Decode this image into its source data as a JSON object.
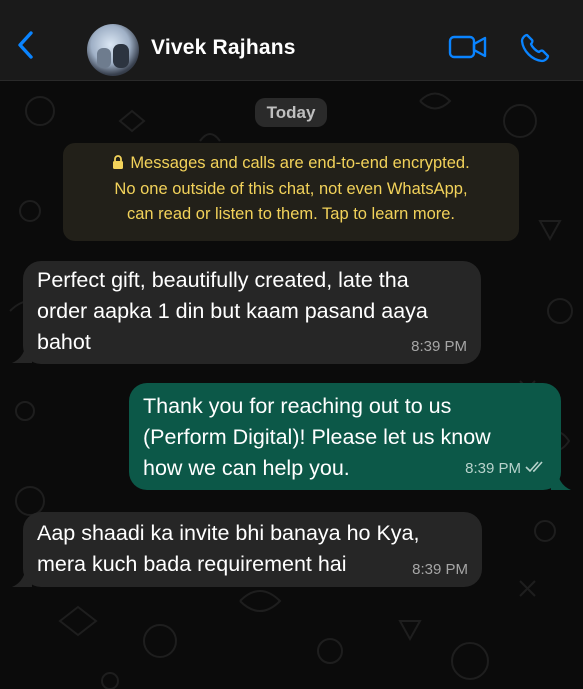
{
  "header": {
    "contact_name": "Vivek Rajhans",
    "icons": {
      "back": "chevron-left-icon",
      "video": "video-camera-icon",
      "call": "phone-icon"
    },
    "accent_color": "#0a84ff"
  },
  "chat": {
    "date_label": "Today",
    "encryption_notice": {
      "lines": [
        "Messages and calls are end-to-end encrypted.",
        "No one outside of this chat, not even WhatsApp,",
        "can read or listen to them. Tap to learn more."
      ],
      "color": "#f2d25a"
    },
    "messages": [
      {
        "direction": "incoming",
        "lines": [
          "Perfect gift, beautifully created, late tha",
          "order aapka 1 din but kaam pasand aaya",
          "bahot"
        ],
        "time": "8:39 PM"
      },
      {
        "direction": "outgoing",
        "lines": [
          "Thank you for reaching out to us",
          "(Perform Digital)! Please let us know",
          "how we can help you."
        ],
        "time": "8:39 PM",
        "status": "read"
      },
      {
        "direction": "incoming",
        "lines": [
          "Aap shaadi ka invite bhi banaya ho Kya,",
          "mera kuch bada requirement hai"
        ],
        "time": "8:39 PM"
      }
    ],
    "colors": {
      "incoming_bubble": "#262626",
      "outgoing_bubble": "#0c5848",
      "background": "#0b0b0b"
    }
  }
}
